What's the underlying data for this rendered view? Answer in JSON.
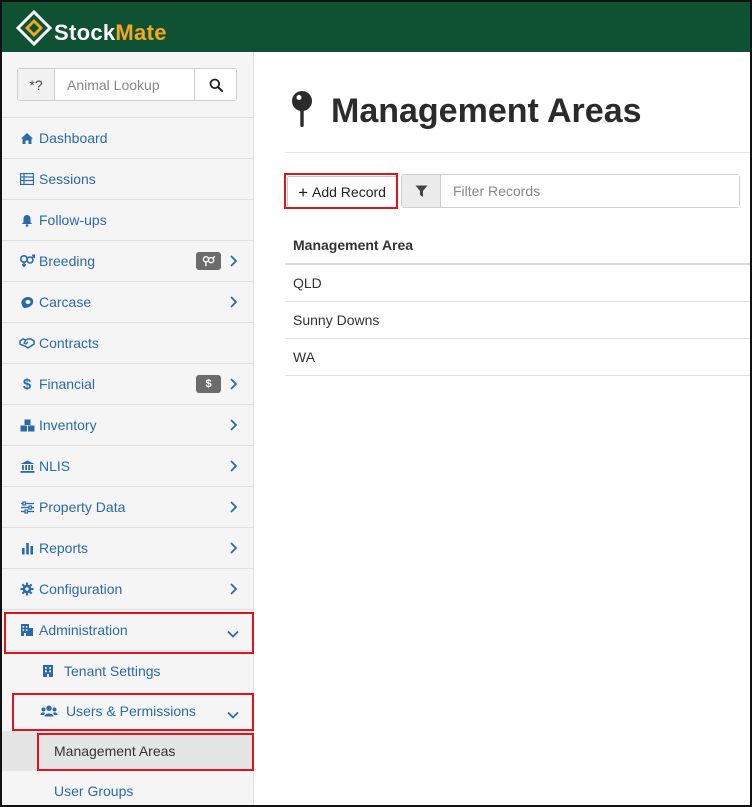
{
  "app": {
    "brand_part1": "Stock",
    "brand_part2": "Mate",
    "brand_color": "#0e5233",
    "accent_color": "#f3a81d",
    "highlight_color": "#e0141e"
  },
  "search": {
    "prefix": "*?",
    "placeholder": "Animal Lookup",
    "button_icon": "search-icon"
  },
  "sidebar": {
    "items": [
      {
        "label": "Dashboard",
        "icon": "home-icon"
      },
      {
        "label": "Sessions",
        "icon": "list-icon"
      },
      {
        "label": "Follow-ups",
        "icon": "bell-icon"
      },
      {
        "label": "Breeding",
        "icon": "venus-mars-icon",
        "badge_icon": "venus-mars-icon",
        "has_chevron": true
      },
      {
        "label": "Carcase",
        "icon": "steak-icon",
        "has_chevron": true
      },
      {
        "label": "Contracts",
        "icon": "handshake-icon"
      },
      {
        "label": "Financial",
        "icon": "dollar-icon",
        "badge": "$",
        "has_chevron": true
      },
      {
        "label": "Inventory",
        "icon": "boxes-icon",
        "has_chevron": true
      },
      {
        "label": "NLIS",
        "icon": "bank-icon",
        "has_chevron": true
      },
      {
        "label": "Property Data",
        "icon": "sliders-icon",
        "has_chevron": true
      },
      {
        "label": "Reports",
        "icon": "bar-chart-icon",
        "has_chevron": true
      },
      {
        "label": "Configuration",
        "icon": "gear-icon",
        "has_chevron": true
      },
      {
        "label": "Administration",
        "icon": "building-icon",
        "expanded": true
      },
      {
        "label": "Tenant Settings",
        "icon": "building-icon"
      },
      {
        "label": "Users & Permissions",
        "icon": "users-icon",
        "expanded": true
      },
      {
        "label": "Management Areas",
        "active": true
      },
      {
        "label": "User Groups"
      }
    ]
  },
  "main": {
    "title": "Management Areas",
    "title_icon": "map-pin-icon",
    "add_button_label": "Add Record",
    "filter_placeholder": "Filter Records",
    "table": {
      "columns": [
        "Management Area"
      ],
      "rows": [
        "QLD",
        "Sunny Downs",
        "WA"
      ]
    }
  }
}
